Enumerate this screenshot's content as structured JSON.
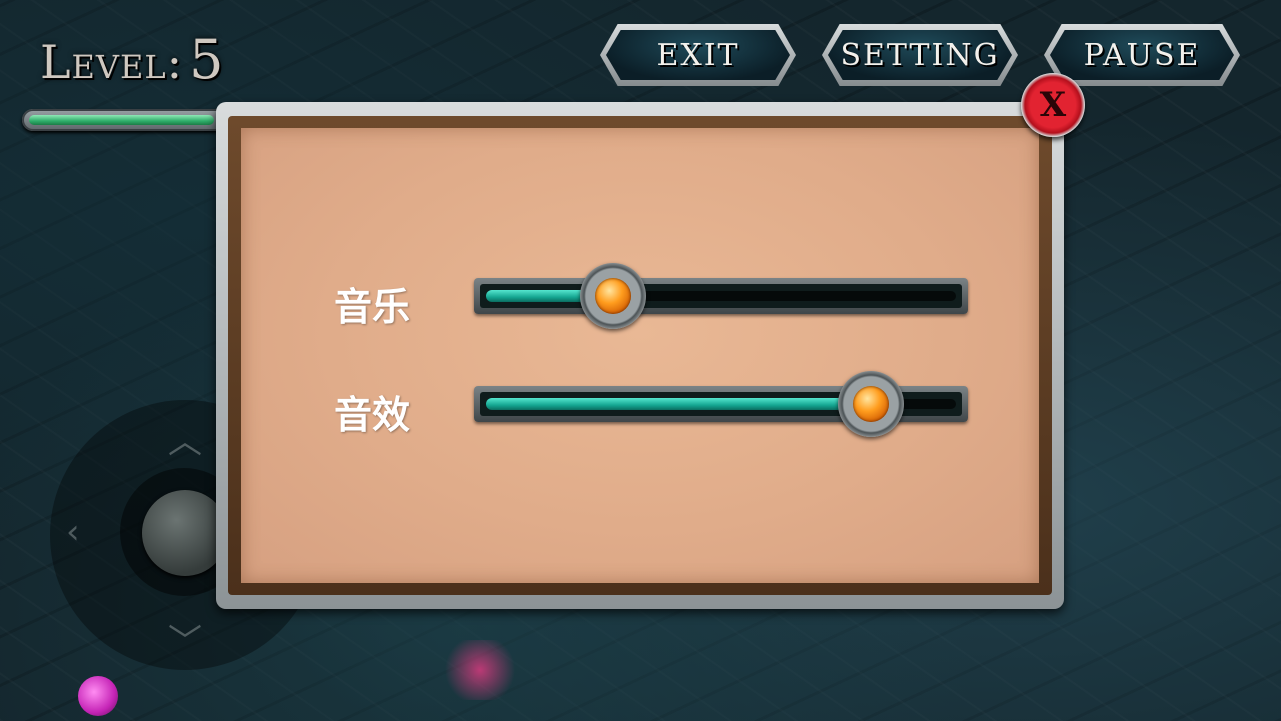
{
  "hud": {
    "level_label": "Level:",
    "level_value": "5",
    "progress_fraction": 0.92
  },
  "top_buttons": {
    "exit": "EXIT",
    "setting": "SETTING",
    "pause": "PAUSE"
  },
  "settings_dialog": {
    "close_label": "X",
    "music": {
      "label": "音乐",
      "level_fraction": 0.27
    },
    "sound_effects": {
      "label": "音效",
      "level_fraction": 0.82
    }
  },
  "icons": [
    "close-icon",
    "up-arrow-icon",
    "left-arrow-icon",
    "down-arrow-icon"
  ],
  "colors": {
    "panel_parchment": "#e0ac8a",
    "slider_fill": "#15a691",
    "thumb_gem": "#ff9d1e",
    "close_red": "#e22331",
    "progress_green": "#2fae6a"
  }
}
